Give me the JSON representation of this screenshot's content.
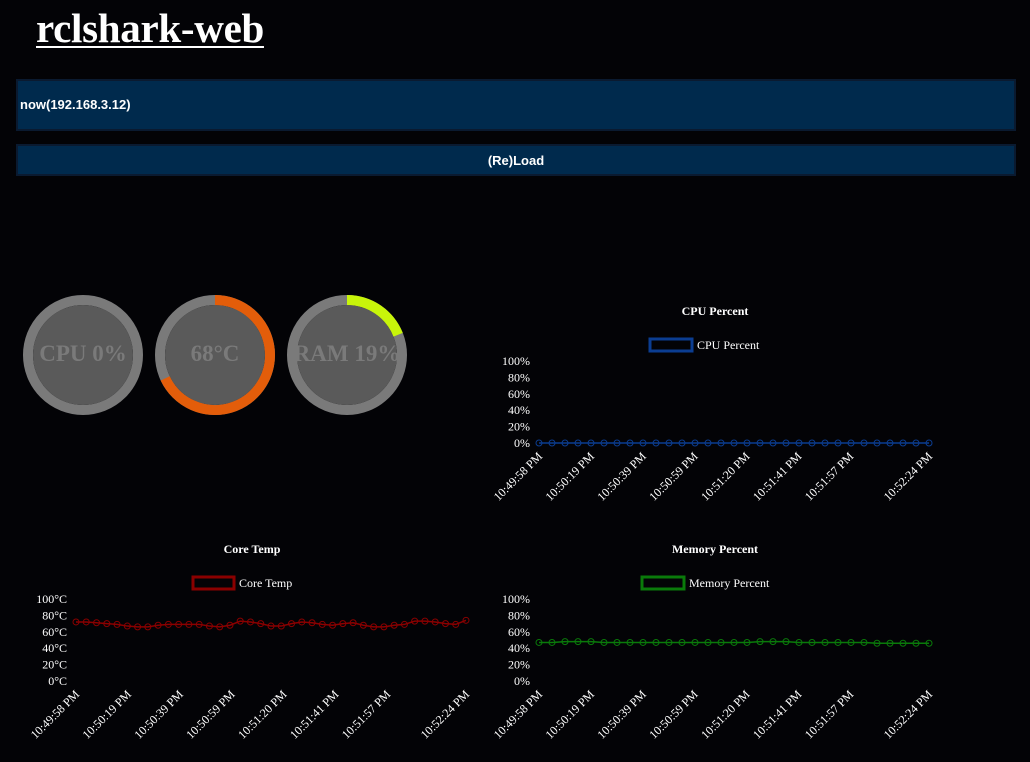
{
  "app": {
    "title": "rclshark-web"
  },
  "host": {
    "label": "now(192.168.3.12)"
  },
  "reload": {
    "label": "(Re)Load"
  },
  "gauges": [
    {
      "label": "CPU 0%",
      "value": 0.0,
      "color": "#7a7a7a"
    },
    {
      "label": "68°C",
      "value": 0.68,
      "color": "#e35d0a"
    },
    {
      "label": "RAM 19%",
      "value": 0.19,
      "color": "#c8f50a"
    }
  ],
  "chart_data": [
    {
      "type": "line",
      "title": "CPU Percent",
      "series": [
        {
          "name": "CPU Percent",
          "color": "#0b3d91",
          "values": [
            0,
            0,
            0,
            0,
            0,
            0,
            0,
            0,
            0,
            0,
            0,
            0,
            0,
            0,
            0,
            0,
            0,
            0,
            0,
            0,
            0,
            0,
            0,
            0,
            0,
            0,
            0,
            0,
            0,
            0,
            0
          ]
        }
      ],
      "x_tick_labels": [
        "10:49:58 PM",
        "10:50:19 PM",
        "10:50:39 PM",
        "10:50:59 PM",
        "10:51:20 PM",
        "10:51:41 PM",
        "10:51:57 PM",
        "10:52:24 PM"
      ],
      "y_tick_labels": [
        "0%",
        "20%",
        "40%",
        "60%",
        "80%",
        "100%"
      ],
      "ylim": [
        0,
        100
      ]
    },
    {
      "type": "line",
      "title": "Core Temp",
      "series": [
        {
          "name": "Core Temp",
          "color": "#8b0000",
          "values": [
            72,
            72,
            71,
            70,
            69,
            67,
            66,
            66,
            68,
            69,
            69,
            69,
            69,
            67,
            66,
            68,
            73,
            72,
            70,
            67,
            67,
            70,
            72,
            71,
            69,
            68,
            70,
            71,
            68,
            66,
            66,
            68,
            69,
            73,
            73,
            72,
            70,
            69,
            74
          ]
        }
      ],
      "x_tick_labels": [
        "10:49:58 PM",
        "10:50:19 PM",
        "10:50:39 PM",
        "10:50:59 PM",
        "10:51:20 PM",
        "10:51:41 PM",
        "10:51:57 PM",
        "10:52:24 PM"
      ],
      "y_tick_labels": [
        "0°C",
        "20°C",
        "40°C",
        "60°C",
        "80°C",
        "100°C"
      ],
      "ylim": [
        0,
        100
      ]
    },
    {
      "type": "line",
      "title": "Memory Percent",
      "series": [
        {
          "name": "Memory Percent",
          "color": "#0a7a0a",
          "values": [
            47,
            47,
            48,
            48,
            48,
            47,
            47,
            47,
            47,
            47,
            47,
            47,
            47,
            47,
            47,
            47,
            47,
            48,
            48,
            48,
            47,
            47,
            47,
            47,
            47,
            47,
            46,
            46,
            46,
            46,
            46
          ]
        }
      ],
      "x_tick_labels": [
        "10:49:58 PM",
        "10:50:19 PM",
        "10:50:39 PM",
        "10:50:59 PM",
        "10:51:20 PM",
        "10:51:41 PM",
        "10:51:57 PM",
        "10:52:24 PM"
      ],
      "y_tick_labels": [
        "0%",
        "20%",
        "40%",
        "60%",
        "80%",
        "100%"
      ],
      "ylim": [
        0,
        100
      ]
    }
  ]
}
